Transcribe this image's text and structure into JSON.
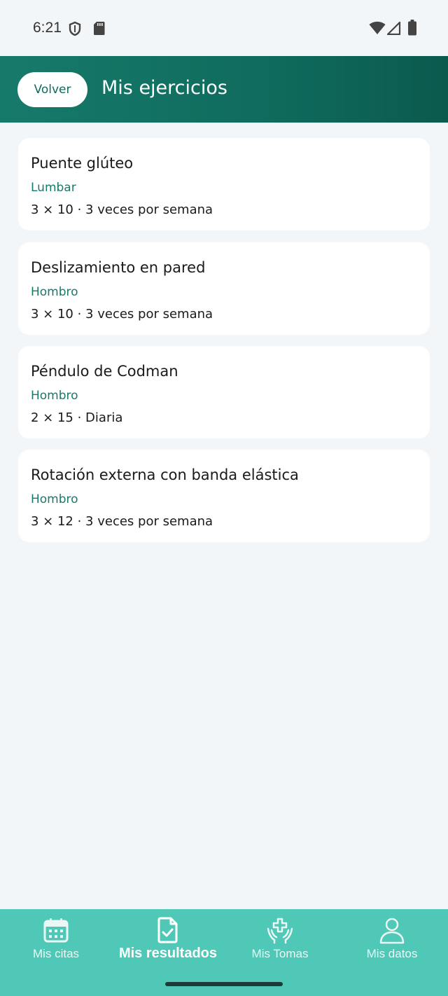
{
  "status_bar": {
    "time": "6:21"
  },
  "header": {
    "back_label": "Volver",
    "title": "Mis ejercicios"
  },
  "exercises": [
    {
      "name": "Puente glúteo",
      "area": "Lumbar",
      "dose": "3 × 10 · 3 veces por semana"
    },
    {
      "name": "Deslizamiento en pared",
      "area": "Hombro",
      "dose": "3 × 10 · 3 veces por semana"
    },
    {
      "name": "Péndulo de Codman",
      "area": "Hombro",
      "dose": "2 × 15 · Diaria"
    },
    {
      "name": "Rotación externa con banda elástica",
      "area": "Hombro",
      "dose": "3 × 12 · 3 veces por semana"
    }
  ],
  "bottom_nav": {
    "items": [
      {
        "label": "Mis citas",
        "icon": "calendar-icon",
        "active": false
      },
      {
        "label": "Mis resultados",
        "icon": "document-check-icon",
        "active": true
      },
      {
        "label": "Mis Tomas",
        "icon": "hands-medical-cross-icon",
        "active": false
      },
      {
        "label": "Mis datos",
        "icon": "person-icon",
        "active": false
      }
    ]
  },
  "colors": {
    "header_start": "#167a6a",
    "header_end": "#0b5a4e",
    "accent_text": "#167a6a",
    "nav_background": "#4fc8b7",
    "page_background": "#f3f6f9"
  }
}
